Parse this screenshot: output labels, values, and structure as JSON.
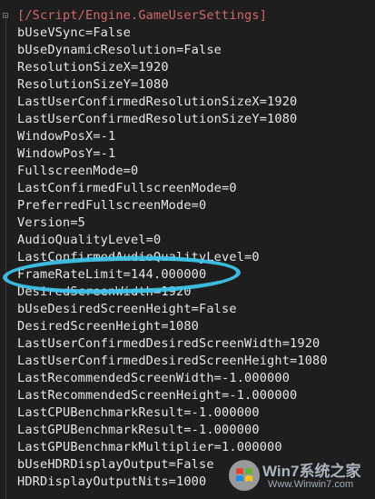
{
  "editor": {
    "section_header": "[/Script/Engine.GameUserSettings]",
    "lines": [
      "bUseVSync=False",
      "bUseDynamicResolution=False",
      "ResolutionSizeX=1920",
      "ResolutionSizeY=1080",
      "LastUserConfirmedResolutionSizeX=1920",
      "LastUserConfirmedResolutionSizeY=1080",
      "WindowPosX=-1",
      "WindowPosY=-1",
      "FullscreenMode=0",
      "LastConfirmedFullscreenMode=0",
      "PreferredFullscreenMode=0",
      "Version=5",
      "AudioQualityLevel=0",
      "LastConfirmedAudioQualityLevel=0",
      "FrameRateLimit=144.000000",
      "DesiredScreenWidth=1920",
      "bUseDesiredScreenHeight=False",
      "DesiredScreenHeight=1080",
      "LastUserConfirmedDesiredScreenWidth=1920",
      "LastUserConfirmedDesiredScreenHeight=1080",
      "LastRecommendedScreenWidth=-1.000000",
      "LastRecommendedScreenHeight=-1.000000",
      "LastCPUBenchmarkResult=-1.000000",
      "LastGPUBenchmarkResult=-1.000000",
      "LastGPUBenchmarkMultiplier=1.000000",
      "bUseHDRDisplayOutput=False",
      "HDRDisplayOutputNits=1000"
    ]
  },
  "annotation": {
    "highlighted_line": "FrameRateLimit=144.000000",
    "color": "#3ec8ef"
  },
  "watermark": {
    "brand": "Win7系统之家",
    "site": "Www.Winwin7.com"
  },
  "colors": {
    "background": "#1e1e1e",
    "text": "#e6e6e6",
    "section": "#d16969"
  }
}
